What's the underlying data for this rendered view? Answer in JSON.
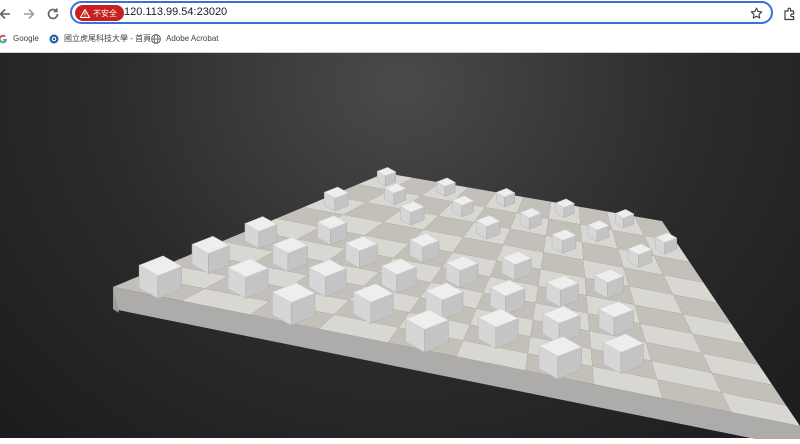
{
  "browser": {
    "address_bar": {
      "security_label": "不安全",
      "url": "120.113.99.54:23020"
    },
    "bookmarks": [
      {
        "label": "Google",
        "icon": "google-icon"
      },
      {
        "label": "國立虎尾科技大學 - 首頁",
        "icon": "ntust-logo-icon"
      },
      {
        "label": "Adobe Acrobat",
        "icon": "globe-icon"
      }
    ],
    "icons": {
      "back": "arrow-left-icon",
      "forward": "arrow-right-icon",
      "reload": "reload-icon",
      "warning": "warning-icon",
      "star": "star-icon",
      "extensions": "puzzle-icon"
    },
    "colors": {
      "omnibox_focus": "#3b6fd9",
      "security_chip": "#c5221f"
    }
  },
  "scene": {
    "description_type": "3d-viewport",
    "board_colors": {
      "light": "#d9d7d2",
      "dark": "#c3c0ba",
      "edge": "#aeacaa"
    },
    "background_color": "#2b2c2d",
    "cube_color": "#eeeeee"
  }
}
